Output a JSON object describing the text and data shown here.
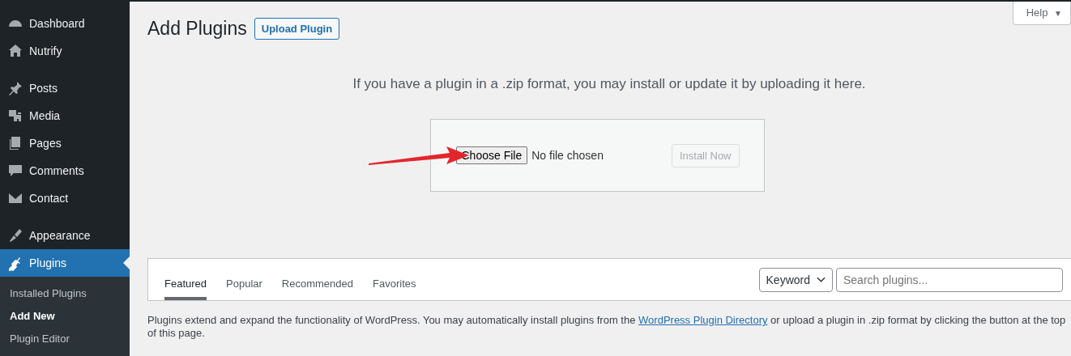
{
  "sidebar": {
    "groups": [
      {
        "items": [
          {
            "label": "Dashboard",
            "selected": false
          },
          {
            "label": "Nutrify",
            "selected": false
          }
        ]
      },
      {
        "items": [
          {
            "label": "Posts",
            "selected": false
          },
          {
            "label": "Media",
            "selected": false
          },
          {
            "label": "Pages",
            "selected": false
          },
          {
            "label": "Comments",
            "selected": false
          },
          {
            "label": "Contact",
            "selected": false
          }
        ]
      },
      {
        "items": [
          {
            "label": "Appearance",
            "selected": false
          },
          {
            "label": "Plugins",
            "selected": true,
            "children": [
              {
                "label": "Installed Plugins",
                "selected": false
              },
              {
                "label": "Add New",
                "selected": true
              },
              {
                "label": "Plugin Editor",
                "selected": false
              }
            ]
          }
        ]
      }
    ]
  },
  "help_tab": {
    "label": "Help",
    "caret": "▼"
  },
  "page_title": "Add Plugins",
  "upload_button": "Upload Plugin",
  "upload_hint": "If you have a plugin in a .zip format, you may install or update it by uploading it here.",
  "file_input": {
    "button": "Choose File",
    "status": "No file chosen"
  },
  "install_button": {
    "label": "Install Now",
    "disabled": true
  },
  "tabs": [
    {
      "label": "Featured",
      "selected": true
    },
    {
      "label": "Popular",
      "selected": false
    },
    {
      "label": "Recommended",
      "selected": false
    },
    {
      "label": "Favorites",
      "selected": false
    }
  ],
  "search_type": {
    "value": "Keyword"
  },
  "search": {
    "placeholder": "Search plugins..."
  },
  "intro": {
    "before": "Plugins extend and expand the functionality of WordPress. You may automatically install plugins from the ",
    "link": "WordPress Plugin Directory",
    "after": " or upload a plugin in .zip format by clicking the button at the top of this page."
  }
}
